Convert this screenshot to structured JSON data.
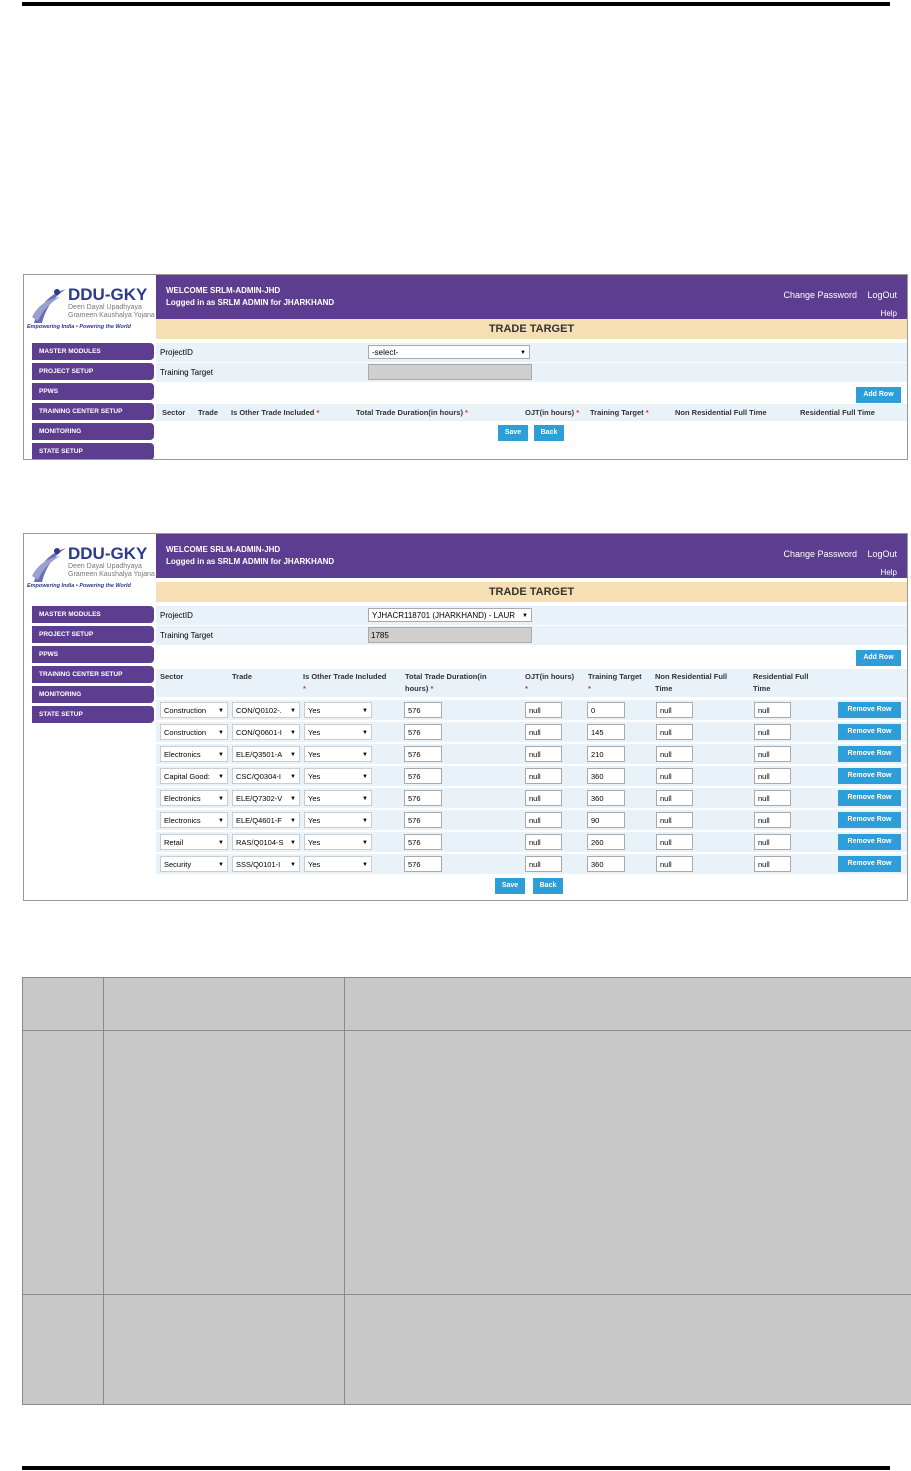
{
  "app": {
    "brand": "DDU-GKY",
    "sub1": "Deen Dayal Upadhyaya",
    "sub2": "Grameen Kaushalya Yojana",
    "tagline": "Empowering India • Powering the World",
    "welcome": "WELCOME  SRLM-ADMIN-JHD",
    "logged_in": "Logged in as   SRLM ADMIN for JHARKHAND",
    "change_password": "Change Password",
    "logout": "LogOut",
    "help": "Help",
    "page_title": "TRADE TARGET"
  },
  "sidebar": {
    "items": [
      "MASTER MODULES",
      "PROJECT SETUP",
      "PPWS",
      "TRAINING CENTER SETUP",
      "MONITORING",
      "STATE SETUP"
    ]
  },
  "form": {
    "project_label": "ProjectID",
    "target_label": "Training Target"
  },
  "buttons": {
    "add_row": "Add Row",
    "save": "Save",
    "back": "Back",
    "remove_row": "Remove Row"
  },
  "shot1": {
    "project_value": "-select-",
    "target_value": "",
    "headers": [
      "Sector",
      "Trade",
      "Is Other Trade Included",
      "Total Trade Duration(in hours)",
      "OJT(in hours)",
      "Training Target",
      "Non Residential Full Time",
      "Residential Full Time"
    ]
  },
  "shot2": {
    "project_value": "YJHACR118701 (JHARKHAND) - LAUR",
    "target_value": "1785",
    "headers": {
      "sector": "Sector",
      "trade": "Trade",
      "other_1": "Is Other Trade Included",
      "other_2": "*",
      "duration_1": "Total Trade Duration(in",
      "duration_2": "hours)",
      "ojt_1": "OJT(in hours)",
      "ojt_2": "*",
      "target_1": "Training Target",
      "target_2": "*",
      "nonres_1": "Non Residential Full",
      "nonres_2": "Time",
      "res_1": "Residential Full",
      "res_2": "Time"
    },
    "rows": [
      {
        "sector": "Construction",
        "trade": "CON/Q0102-.",
        "other": "Yes",
        "duration": "576",
        "ojt": "null",
        "target": "0",
        "nonres": "null",
        "res": "null"
      },
      {
        "sector": "Construction",
        "trade": "CON/Q0601-I",
        "other": "Yes",
        "duration": "576",
        "ojt": "null",
        "target": "145",
        "nonres": "null",
        "res": "null"
      },
      {
        "sector": "Electronics",
        "trade": "ELE/Q3501-A",
        "other": "Yes",
        "duration": "576",
        "ojt": "null",
        "target": "210",
        "nonres": "null",
        "res": "null"
      },
      {
        "sector": "Capital Good:",
        "trade": "CSC/Q0304-I",
        "other": "Yes",
        "duration": "576",
        "ojt": "null",
        "target": "360",
        "nonres": "null",
        "res": "null"
      },
      {
        "sector": "Electronics",
        "trade": "ELE/Q7302-V",
        "other": "Yes",
        "duration": "576",
        "ojt": "null",
        "target": "360",
        "nonres": "null",
        "res": "null"
      },
      {
        "sector": "Electronics",
        "trade": "ELE/Q4601-F",
        "other": "Yes",
        "duration": "576",
        "ojt": "null",
        "target": "90",
        "nonres": "null",
        "res": "null"
      },
      {
        "sector": "Retail",
        "trade": "RAS/Q0104-S",
        "other": "Yes",
        "duration": "576",
        "ojt": "null",
        "target": "260",
        "nonres": "null",
        "res": "null"
      },
      {
        "sector": "Security",
        "trade": "SSS/Q0101-I",
        "other": "Yes",
        "duration": "576",
        "ojt": "null",
        "target": "360",
        "nonres": "null",
        "res": "null"
      }
    ]
  },
  "colors": {
    "header": "#5c3d8f",
    "title_bar": "#f6dfb2",
    "button": "#2e9ed9",
    "row_bg": "#e8f2f8",
    "doc_table": "#c8c8c8"
  }
}
